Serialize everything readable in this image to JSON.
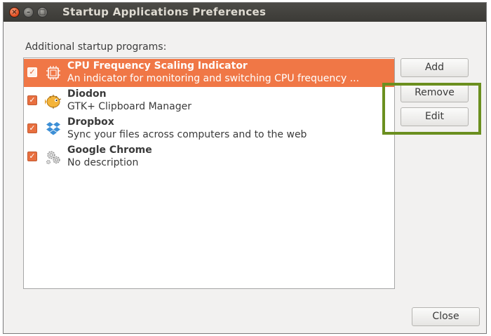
{
  "window": {
    "title": "Startup Applications Preferences",
    "controls": {
      "close": "×",
      "minimize": "–",
      "maximize": "□"
    }
  },
  "section_label": "Additional startup programs:",
  "programs": [
    {
      "name": "CPU Frequency Scaling Indicator",
      "description": "An indicator for monitoring and switching CPU frequency ...",
      "checked": true,
      "selected": true,
      "icon": "cpu-chip-icon"
    },
    {
      "name": "Diodon",
      "description": "GTK+ Clipboard Manager",
      "checked": true,
      "selected": false,
      "icon": "diodon-fish-icon"
    },
    {
      "name": "Dropbox",
      "description": "Sync your files across computers and to the web",
      "checked": true,
      "selected": false,
      "icon": "dropbox-icon"
    },
    {
      "name": "Google Chrome",
      "description": "No description",
      "checked": true,
      "selected": false,
      "icon": "gears-icon"
    }
  ],
  "buttons": {
    "add": "Add",
    "remove": "Remove",
    "edit": "Edit",
    "close": "Close"
  },
  "colors": {
    "selection": "#f07746",
    "checkbox": "#e86f3f",
    "highlight_frame": "#6b8f1f",
    "titlebar": "#3c3b37"
  },
  "checkmark": "✓"
}
